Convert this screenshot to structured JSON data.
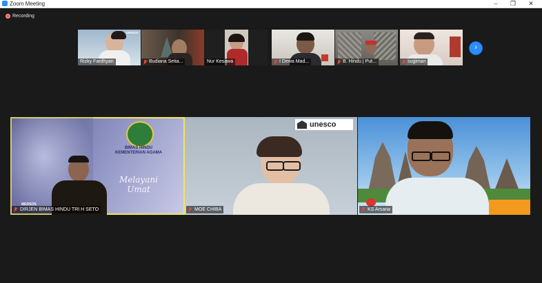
{
  "window": {
    "title": "Zoom Meeting",
    "minimize": "–",
    "maximize": "❐",
    "close": "✕"
  },
  "recording": {
    "label": "Recording"
  },
  "thumbnails": [
    {
      "name": "Rizky Fardhyan"
    },
    {
      "name": "Budiana Setia..."
    },
    {
      "name": "Nur Kesawa"
    },
    {
      "name": "I Dewa Mad..."
    },
    {
      "name": "B. Hindu | Put..."
    },
    {
      "name": "sugiman"
    }
  ],
  "thumb_overlay_text": "unesco",
  "next_button": {
    "label": "›"
  },
  "main_tiles": [
    {
      "name": "DIRJEN BIMAS HINDU TRI H SETO",
      "watermark": "MEDSOS",
      "org_line1": "BIMAS HINDU",
      "org_line2": "KEMENTERIAN AGAMA",
      "slogan": "Melayani Umat"
    },
    {
      "name": "MOE CHIBA",
      "logo_text": "unesco"
    },
    {
      "name": "KS Arsana"
    }
  ],
  "colors": {
    "accent": "#2d8cff",
    "active_border": "#f2e55d",
    "muted": "#e24a3a"
  }
}
